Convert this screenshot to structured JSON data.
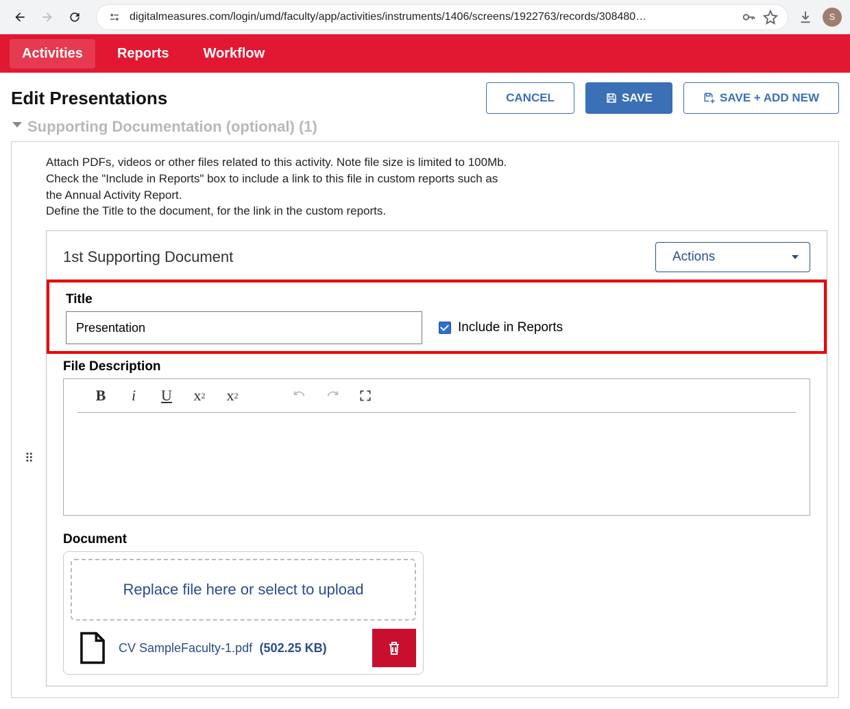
{
  "browser": {
    "url": "digitalmeasures.com/login/umd/faculty/app/activities/instruments/1406/screens/1922763/records/308480…",
    "avatar_letter": "S"
  },
  "nav": {
    "tabs": [
      "Activities",
      "Reports",
      "Workflow"
    ]
  },
  "header": {
    "title": "Edit Presentations",
    "cancel": "CANCEL",
    "save": "SAVE",
    "save_add": "SAVE + ADD NEW"
  },
  "section": {
    "heading": "Supporting Documentation (optional) (1)",
    "instructions_line1": "Attach PDFs, videos or other files related to this activity. Note file size is limited to 100Mb.",
    "instructions_line2": "Check the \"Include in Reports\" box to include a link to this file in custom reports such as the Annual Activity Report.",
    "instructions_line3": "Define the Title to the document, for the link in the custom reports."
  },
  "document": {
    "card_title": "1st Supporting Document",
    "actions_label": "Actions",
    "title_label": "Title",
    "title_value": "Presentation",
    "include_label": "Include in Reports",
    "include_checked": true,
    "desc_label": "File Description",
    "doc_label": "Document",
    "dropzone_text": "Replace file here or select to upload",
    "file_name": "CV SampleFaculty-1.pdf",
    "file_size": "(502.25 KB)"
  }
}
